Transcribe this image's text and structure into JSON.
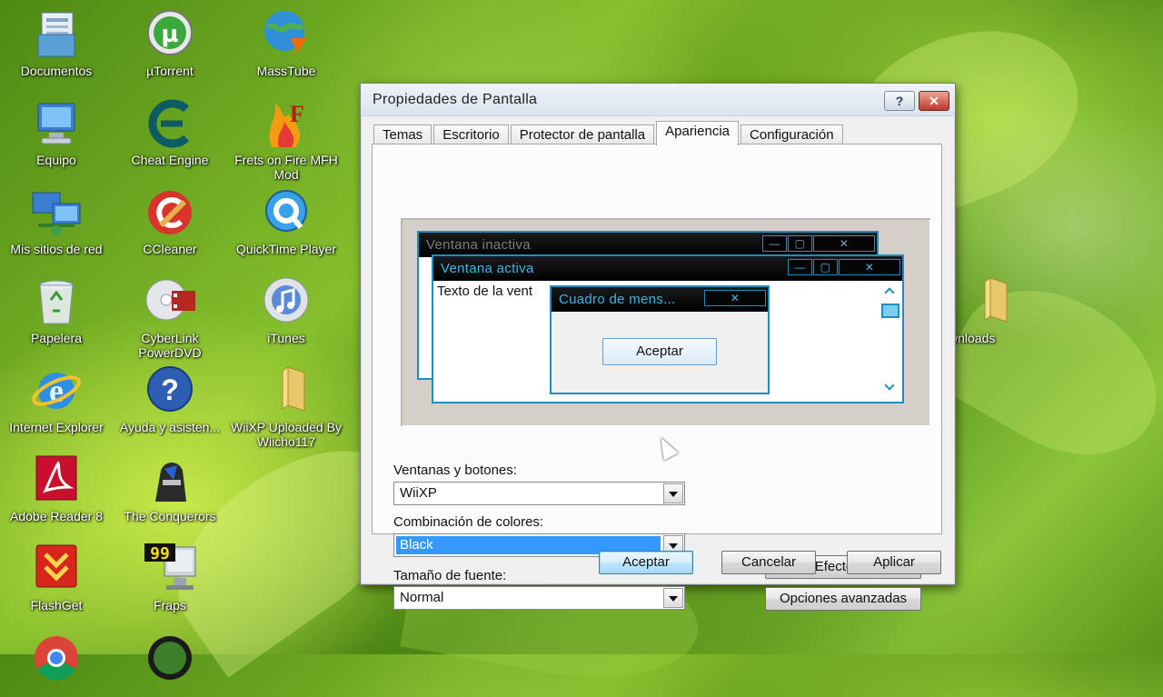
{
  "desktop": {
    "icons": [
      {
        "label": "Documentos",
        "icon": "documents-folder-icon"
      },
      {
        "label": "µTorrent",
        "icon": "utorrent-icon"
      },
      {
        "label": "MassTube",
        "icon": "masstube-globe-icon"
      },
      {
        "label": "Equipo",
        "icon": "computer-icon"
      },
      {
        "label": "Cheat Engine",
        "icon": "cheat-engine-icon"
      },
      {
        "label": "Frets on Fire MFH Mod",
        "icon": "frets-on-fire-icon"
      },
      {
        "label": "Mis sitios de red",
        "icon": "network-places-icon"
      },
      {
        "label": "CCleaner",
        "icon": "ccleaner-icon"
      },
      {
        "label": "QuickTime Player",
        "icon": "quicktime-icon"
      },
      {
        "label": "Papelera",
        "icon": "recycle-bin-icon"
      },
      {
        "label": "CyberLink PowerDVD",
        "icon": "powerdvd-icon"
      },
      {
        "label": "iTunes",
        "icon": "itunes-icon"
      },
      {
        "label": "Internet Explorer",
        "icon": "internet-explorer-icon"
      },
      {
        "label": "Ayuda y asisten...",
        "icon": "help-icon"
      },
      {
        "label": "WiiXP Uploaded By Wiicho117",
        "icon": "folder-icon"
      },
      {
        "label": "Adobe Reader 8",
        "icon": "adobe-reader-icon"
      },
      {
        "label": "The Conquerors",
        "icon": "conquerors-icon"
      },
      {
        "label": "FlashGet",
        "icon": "flashget-icon"
      },
      {
        "label": "Fraps",
        "icon": "fraps-icon"
      },
      {
        "label": "wnloads",
        "icon": "downloads-folder-icon"
      }
    ]
  },
  "dialog": {
    "title": "Propiedades de Pantalla",
    "help_button": "?",
    "close_button": "✕",
    "tabs": [
      "Temas",
      "Escritorio",
      "Protector de pantalla",
      "Apariencia",
      "Configuración"
    ],
    "active_tab": "Apariencia",
    "preview": {
      "inactive_title": "Ventana inactiva",
      "active_title": "Ventana activa",
      "window_text": "Texto de la vent",
      "message_title": "Cuadro de mens...",
      "message_button": "Aceptar",
      "minimize": "—",
      "maximize": "▢",
      "close": "✕"
    },
    "windows_buttons": {
      "label": "Ventanas y botones:",
      "value": "WiiXP"
    },
    "color_scheme": {
      "label": "Combinación de colores:",
      "value": "Black"
    },
    "font_size": {
      "label": "Tamaño de fuente:",
      "value": "Normal"
    },
    "effects_button": "Efectos...",
    "advanced_button": "Opciones avanzadas",
    "ok_button": "Aceptar",
    "cancel_button": "Cancelar",
    "apply_button": "Aplicar"
  },
  "colors": {
    "preview_accent": "#1d8fbf",
    "selection": "#3399ff"
  }
}
